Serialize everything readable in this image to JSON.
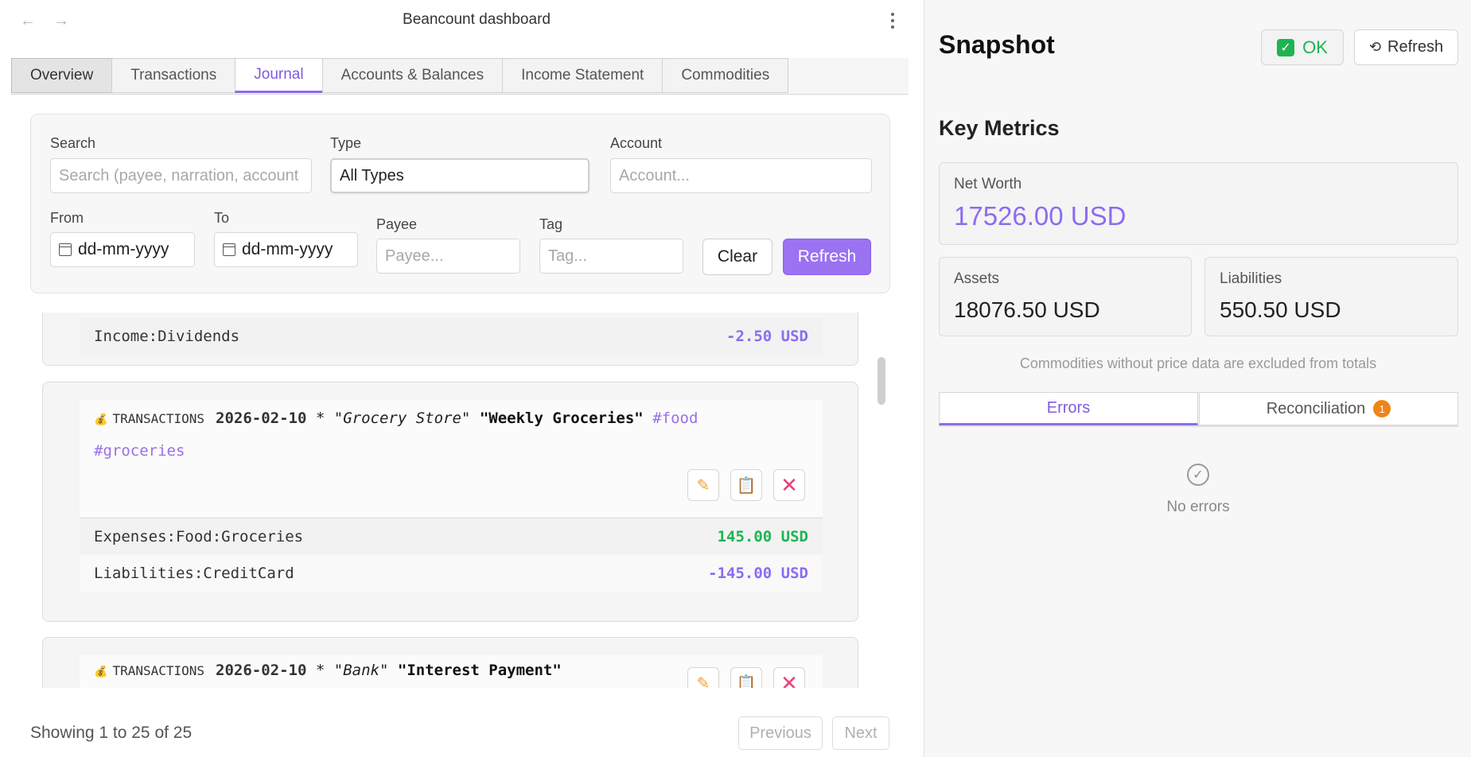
{
  "app": {
    "title": "Beancount dashboard"
  },
  "nav": {
    "back_icon": "arrow-left-icon",
    "forward_icon": "arrow-right-icon",
    "menu_icon": "kebab-menu-icon"
  },
  "tabs": [
    {
      "label": "Overview"
    },
    {
      "label": "Transactions"
    },
    {
      "label": "Journal"
    },
    {
      "label": "Accounts & Balances"
    },
    {
      "label": "Income Statement"
    },
    {
      "label": "Commodities"
    }
  ],
  "filters": {
    "search_label": "Search",
    "search_placeholder": "Search (payee, narration, account",
    "type_label": "Type",
    "type_value": "All Types",
    "account_label": "Account",
    "account_placeholder": "Account...",
    "from_label": "From",
    "from_value": "dd-mm-yyyy",
    "to_label": "To",
    "to_value": "dd-mm-yyyy",
    "payee_label": "Payee",
    "payee_placeholder": "Payee...",
    "tag_label": "Tag",
    "tag_placeholder": "Tag...",
    "clear_label": "Clear",
    "refresh_label": "Refresh"
  },
  "journal": {
    "partial_posting": {
      "account": "Income:Dividends",
      "amount": "-2.50 USD"
    },
    "transactions": [
      {
        "keyword": "TRANSACTIONS",
        "date": "2026-02-10",
        "flag": "*",
        "payee": "\"Grocery Store\"",
        "narration": "\"Weekly Groceries\"",
        "tag1": "#food",
        "tag2": "#groceries",
        "postings": [
          {
            "account": "Expenses:Food:Groceries",
            "amount": "145.00 USD"
          },
          {
            "account": "Liabilities:CreditCard",
            "amount": "-145.00 USD"
          }
        ]
      },
      {
        "keyword": "TRANSACTIONS",
        "date": "2026-02-10",
        "flag": "*",
        "payee": "\"Bank\"",
        "narration": "\"Interest Payment\""
      }
    ]
  },
  "pagination": {
    "status": "Showing 1 to 25 of 25",
    "prev_label": "Previous",
    "next_label": "Next"
  },
  "snapshot": {
    "title": "Snapshot",
    "ok_label": "OK",
    "refresh_label": "Refresh",
    "metrics_title": "Key Metrics",
    "net_worth_label": "Net Worth",
    "net_worth_value": "17526.00 USD",
    "assets_label": "Assets",
    "assets_value": "18076.50 USD",
    "liabilities_label": "Liabilities",
    "liabilities_value": "550.50 USD",
    "note": "Commodities without price data are excluded from totals",
    "errors_tab": "Errors",
    "reconciliation_tab": "Reconciliation",
    "reconciliation_count": "1",
    "no_errors": "No errors"
  },
  "colors": {
    "accent": "#8b6cf0",
    "positive": "#1fb452",
    "badge": "#f08416",
    "delete": "#e8407a"
  }
}
